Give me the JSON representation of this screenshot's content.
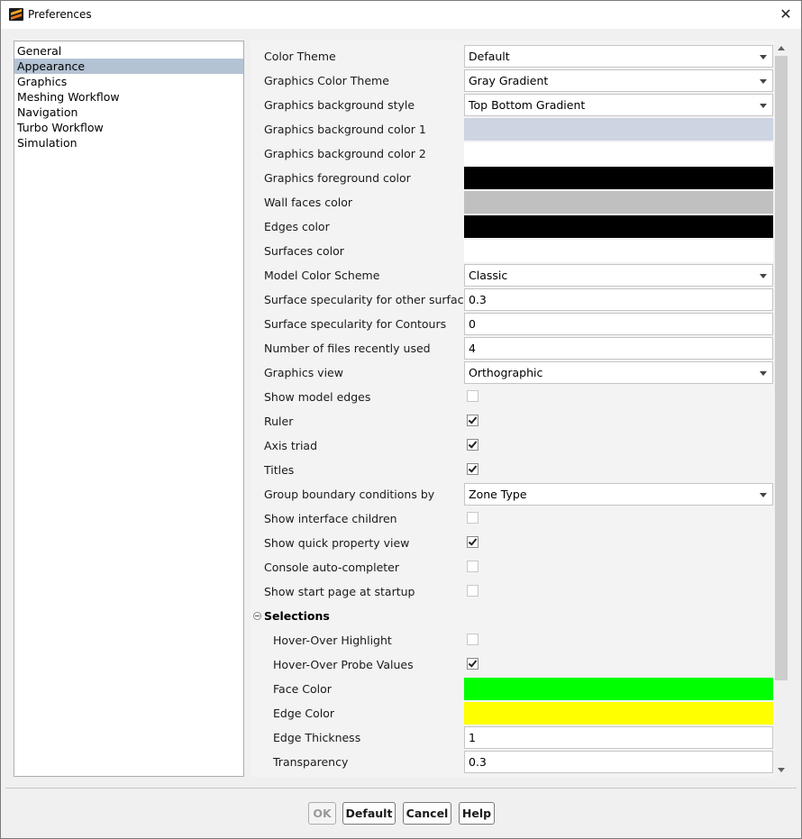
{
  "window": {
    "title": "Preferences",
    "close_glyph": "✕"
  },
  "nav": {
    "items": [
      {
        "label": "General",
        "selected": false
      },
      {
        "label": "Appearance",
        "selected": true
      },
      {
        "label": "Graphics",
        "selected": false
      },
      {
        "label": "Meshing Workflow",
        "selected": false
      },
      {
        "label": "Navigation",
        "selected": false
      },
      {
        "label": "Turbo Workflow",
        "selected": false
      },
      {
        "label": "Simulation",
        "selected": false
      }
    ]
  },
  "settings": [
    {
      "label": "Color Theme",
      "type": "select",
      "value": "Default"
    },
    {
      "label": "Graphics Color Theme",
      "type": "select",
      "value": "Gray Gradient"
    },
    {
      "label": "Graphics background style",
      "type": "select",
      "value": "Top Bottom Gradient"
    },
    {
      "label": "Graphics background color 1",
      "type": "color",
      "color": "#cdd4e2"
    },
    {
      "label": "Graphics background color 2",
      "type": "color",
      "color": "#ffffff"
    },
    {
      "label": "Graphics foreground color",
      "type": "color",
      "color": "#000000"
    },
    {
      "label": "Wall faces color",
      "type": "color",
      "color": "#c0c0c0"
    },
    {
      "label": "Edges color",
      "type": "color",
      "color": "#000000"
    },
    {
      "label": "Surfaces color",
      "type": "color",
      "color": "#ffffff"
    },
    {
      "label": "Model Color Scheme",
      "type": "select",
      "value": "Classic"
    },
    {
      "label": "Surface specularity for other surfaces",
      "type": "text",
      "value": "0.3"
    },
    {
      "label": "Surface specularity for Contours",
      "type": "text",
      "value": "0"
    },
    {
      "label": "Number of files recently used",
      "type": "text",
      "value": "4"
    },
    {
      "label": "Graphics view",
      "type": "select",
      "value": "Orthographic"
    },
    {
      "label": "Show model edges",
      "type": "checkbox",
      "checked": false,
      "enabled": false
    },
    {
      "label": "Ruler",
      "type": "checkbox",
      "checked": true,
      "enabled": true
    },
    {
      "label": "Axis triad",
      "type": "checkbox",
      "checked": true,
      "enabled": true
    },
    {
      "label": "Titles",
      "type": "checkbox",
      "checked": true,
      "enabled": true
    },
    {
      "label": "Group boundary conditions by",
      "type": "select",
      "value": "Zone Type"
    },
    {
      "label": "Show interface children",
      "type": "checkbox",
      "checked": false,
      "enabled": false
    },
    {
      "label": "Show quick property view",
      "type": "checkbox",
      "checked": true,
      "enabled": true
    },
    {
      "label": "Console auto-completer",
      "type": "checkbox",
      "checked": false,
      "enabled": false
    },
    {
      "label": "Show start page at startup",
      "type": "checkbox",
      "checked": false,
      "enabled": false
    }
  ],
  "selections": {
    "header": "Selections",
    "items": [
      {
        "label": "Hover-Over Highlight",
        "type": "checkbox",
        "checked": false,
        "enabled": false
      },
      {
        "label": "Hover-Over Probe Values",
        "type": "checkbox",
        "checked": true,
        "enabled": true
      },
      {
        "label": "Face Color",
        "type": "color",
        "color": "#00ff00"
      },
      {
        "label": "Edge Color",
        "type": "color",
        "color": "#ffff00"
      },
      {
        "label": "Edge Thickness",
        "type": "text",
        "value": "1"
      },
      {
        "label": "Transparency",
        "type": "text",
        "value": "0.3"
      }
    ]
  },
  "buttons": {
    "ok": "OK",
    "default": "Default",
    "cancel": "Cancel",
    "help": "Help"
  }
}
